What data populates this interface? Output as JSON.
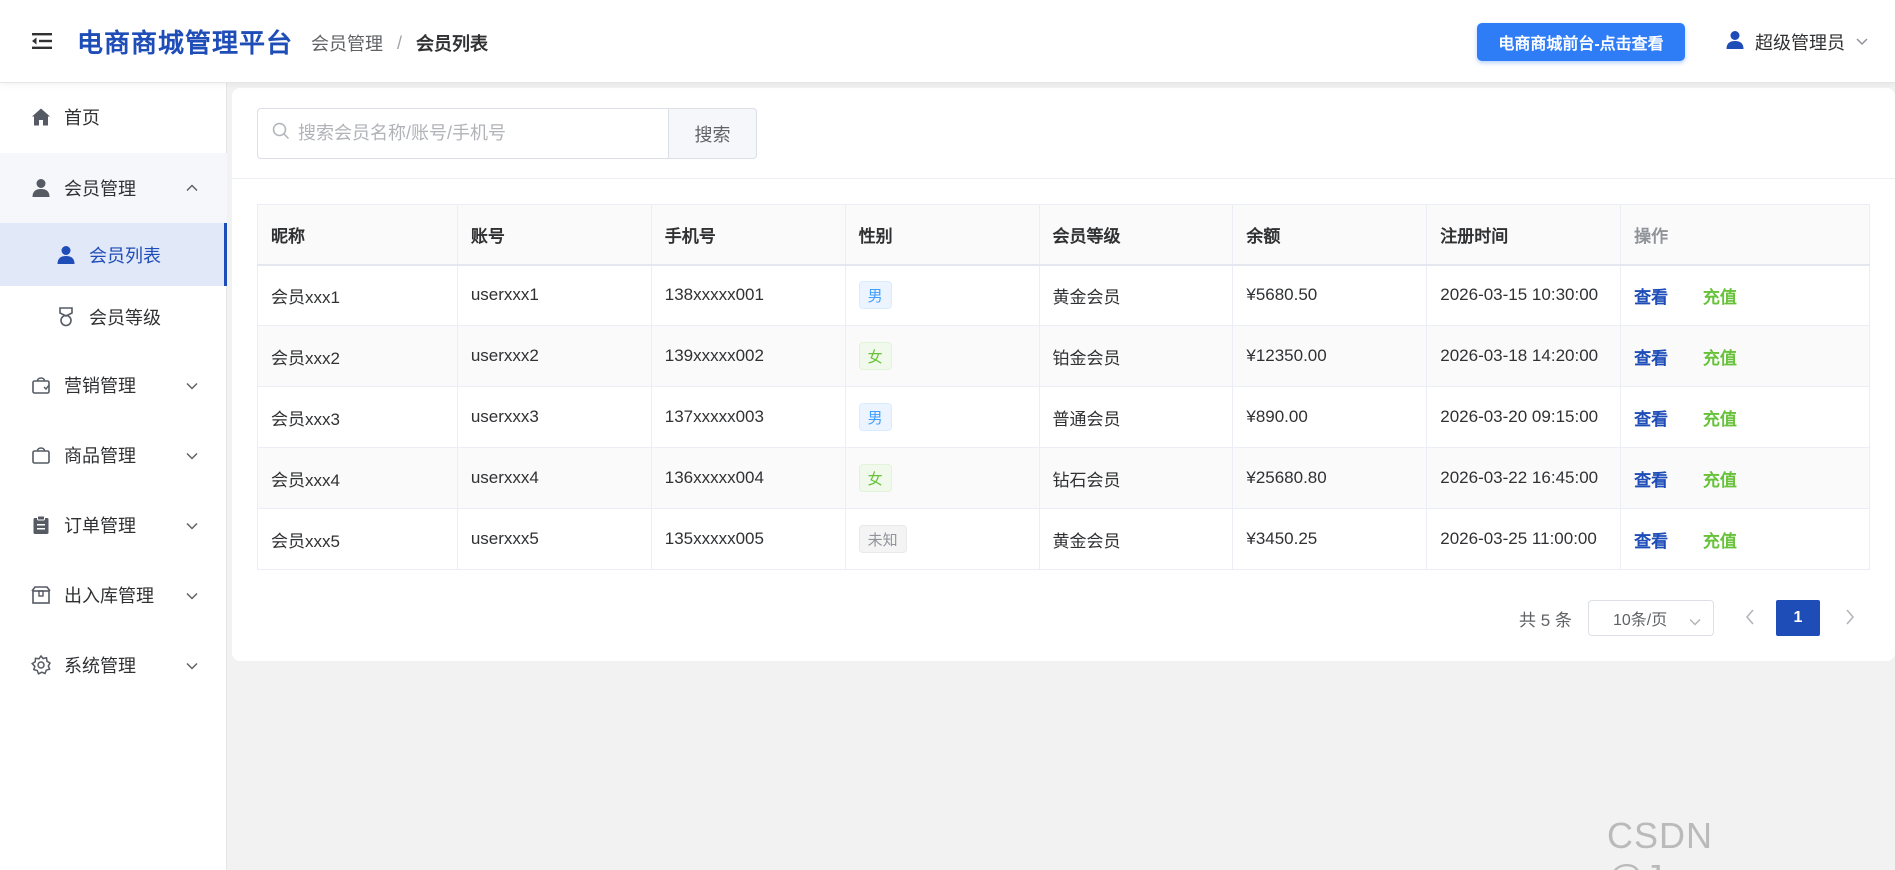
{
  "header": {
    "brand": "电商商城管理平台",
    "breadcrumb": {
      "parent": "会员管理",
      "separator": "/",
      "current": "会员列表"
    },
    "front_button": "电商商城前台-点击查看",
    "user_name": "超级管理员"
  },
  "sidebar": {
    "items": [
      {
        "label": "首页",
        "icon": "home-icon"
      },
      {
        "label": "会员管理",
        "icon": "user-icon",
        "expanded": true
      },
      {
        "label": "会员列表",
        "icon": "user-icon",
        "active": true
      },
      {
        "label": "会员等级",
        "icon": "medal-icon"
      },
      {
        "label": "营销管理",
        "icon": "shopping-bag-icon"
      },
      {
        "label": "商品管理",
        "icon": "bag-icon"
      },
      {
        "label": "订单管理",
        "icon": "clipboard-icon"
      },
      {
        "label": "出入库管理",
        "icon": "package-icon"
      },
      {
        "label": "系统管理",
        "icon": "gear-icon"
      }
    ]
  },
  "search": {
    "placeholder": "搜索会员名称/账号/手机号",
    "value": "",
    "button_label": "搜索"
  },
  "table": {
    "columns": [
      "昵称",
      "账号",
      "手机号",
      "性别",
      "会员等级",
      "余额",
      "注册时间",
      "操作"
    ],
    "rows": [
      {
        "nickname": "会员xxx1",
        "account": "userxxx1",
        "phone": "138xxxxx001",
        "gender": "男",
        "level": "黄金会员",
        "balance": "¥5680.50",
        "registered": "2026-03-15 10:30:00"
      },
      {
        "nickname": "会员xxx2",
        "account": "userxxx2",
        "phone": "139xxxxx002",
        "gender": "女",
        "level": "铂金会员",
        "balance": "¥12350.00",
        "registered": "2026-03-18 14:20:00"
      },
      {
        "nickname": "会员xxx3",
        "account": "userxxx3",
        "phone": "137xxxxx003",
        "gender": "男",
        "level": "普通会员",
        "balance": "¥890.00",
        "registered": "2026-03-20 09:15:00"
      },
      {
        "nickname": "会员xxx4",
        "account": "userxxx4",
        "phone": "136xxxxx004",
        "gender": "女",
        "level": "钻石会员",
        "balance": "¥25680.80",
        "registered": "2026-03-22 16:45:00"
      },
      {
        "nickname": "会员xxx5",
        "account": "userxxx5",
        "phone": "135xxxxx005",
        "gender": "未知",
        "level": "黄金会员",
        "balance": "¥3450.25",
        "registered": "2026-03-25 11:00:00"
      }
    ],
    "actions": {
      "view": "查看",
      "recharge": "充值"
    }
  },
  "pagination": {
    "total_label": "共 5 条",
    "page_size": "10条/页",
    "current_page": "1"
  },
  "watermark": "CSDN @Json____",
  "colors": {
    "brand": "#1f4db8",
    "button": "#2e7cf6",
    "tag_male": "#409eff",
    "tag_female": "#67c23a",
    "tag_unknown": "#909399",
    "recharge": "#67c23a"
  }
}
